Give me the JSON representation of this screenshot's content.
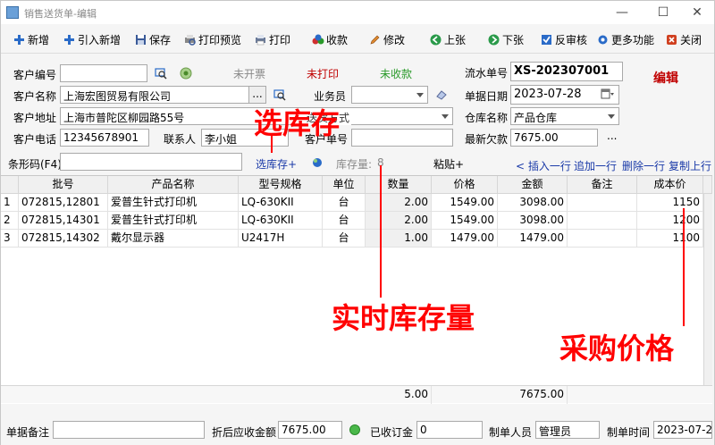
{
  "window": {
    "title": "销售送货单-编辑",
    "minimize": "—",
    "maximize": "☐",
    "close": "✕"
  },
  "toolbar": {
    "new": "新增",
    "import_new": "引入新增",
    "save": "保存",
    "print_preview": "打印预览",
    "print": "打印",
    "receive": "收款",
    "modify": "修改",
    "prev": "上张",
    "next": "下张",
    "unaudit": "反审核",
    "more": "更多功能",
    "close": "关闭"
  },
  "form": {
    "customer_code_label": "客户编号",
    "customer_code": "",
    "customer_name_label": "客户名称",
    "customer_name": "上海宏图贸易有限公司",
    "customer_addr_label": "客户地址",
    "customer_addr": "上海市普陀区柳园路55号",
    "customer_phone_label": "客户电话",
    "customer_phone": "12345678901",
    "contact_label": "联系人",
    "contact": "李小姐",
    "invoice_status": "未开票",
    "print_status": "未打印",
    "receipt_status": "未收款",
    "salesman_label": "业务员",
    "salesman": "",
    "delivery_label": "送货方式",
    "customer_order_label": "客户单号",
    "customer_order": "",
    "serial_label": "流水单号",
    "serial": "XS-202307001",
    "date_label": "单据日期",
    "date": "2023-07-28",
    "warehouse_label": "仓库名称",
    "warehouse": "产品仓库",
    "latest_debt_label": "最新欠款",
    "latest_debt": "7675.00",
    "edit_tag": "编辑",
    "ellipsis": "...",
    "ellipsis2": "..."
  },
  "barcode": {
    "label": "条形码(F4)",
    "value": "",
    "select_stock": "选库存+",
    "stock_qty_label": "库存量:",
    "stock_qty": "8",
    "paste": "粘贴+",
    "insert_row": "< 插入一行",
    "append_row": "追加一行",
    "delete_row": "删除一行",
    "copy_up": "复制上行"
  },
  "grid": {
    "headers": [
      "批号",
      "产品名称",
      "型号规格",
      "单位",
      "数量",
      "价格",
      "金额",
      "备注",
      "成本价"
    ],
    "rows": [
      {
        "idx": "1",
        "batch": "072815,12801",
        "name": "爱普生针式打印机",
        "model": "LQ-630KII",
        "unit": "台",
        "qty": "2.00",
        "price": "1549.00",
        "amount": "3098.00",
        "note": "",
        "cost": "1150"
      },
      {
        "idx": "2",
        "batch": "072815,14301",
        "name": "爱普生针式打印机",
        "model": "LQ-630KII",
        "unit": "台",
        "qty": "2.00",
        "price": "1549.00",
        "amount": "3098.00",
        "note": "",
        "cost": "1200"
      },
      {
        "idx": "3",
        "batch": "072815,14302",
        "name": "戴尔显示器",
        "model": "U2417H",
        "unit": "台",
        "qty": "1.00",
        "price": "1479.00",
        "amount": "1479.00",
        "note": "",
        "cost": "1100"
      }
    ],
    "total_qty": "5.00",
    "total_amount": "7675.00"
  },
  "bottom": {
    "remark_label": "单据备注",
    "remark": "",
    "discount_label": "折后应收金额",
    "discount": "7675.00",
    "deposit_label": "已收订金",
    "deposit": "0",
    "maker_label": "制单人员",
    "maker": "管理员",
    "make_time_label": "制单时间",
    "make_time": "2023-07-28"
  },
  "annotations": {
    "select_stock": "选库存",
    "realtime_stock": "实时库存量",
    "purchase_price": "采购价格"
  },
  "colors": {
    "annotation": "#ff0000",
    "status_red": "#c00000",
    "status_green": "#2a9a2a",
    "link_blue": "#1a3aa8"
  }
}
